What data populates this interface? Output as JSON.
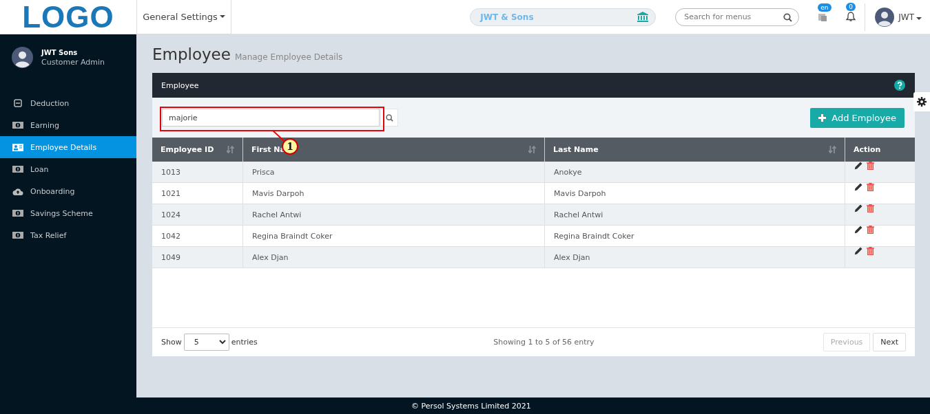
{
  "topbar": {
    "logo": "LOGO",
    "menu": "General Settings",
    "company": "JWT & Sons",
    "search": {
      "placeholder": "Search for menus"
    },
    "language_badge": "en",
    "notifications": "0",
    "user": "JWT"
  },
  "sidebar": {
    "user": {
      "name": "JWT Sons",
      "role": "Customer Admin"
    },
    "items": [
      {
        "label": "Deduction",
        "kind": "minus",
        "selected": false
      },
      {
        "label": "Earning",
        "kind": "bill",
        "selected": false
      },
      {
        "label": "Employee Details",
        "kind": "card",
        "selected": true
      },
      {
        "label": "Loan",
        "kind": "bill",
        "selected": false
      },
      {
        "label": "Onboarding",
        "kind": "cloud",
        "selected": false
      },
      {
        "label": "Savings Scheme",
        "kind": "bill",
        "selected": false
      },
      {
        "label": "Tax Relief",
        "kind": "bill",
        "selected": false
      }
    ]
  },
  "page": {
    "title": "Employee",
    "subtitle": "Manage Employee Details"
  },
  "panel": {
    "title": "Employee",
    "search": {
      "value": "majorie"
    },
    "add_button": "Add Employee",
    "callout": "1"
  },
  "table": {
    "columns": [
      {
        "label": "Employee ID",
        "sortable": true
      },
      {
        "label": "First Na",
        "sortable": true
      },
      {
        "label": "Last Name",
        "sortable": true
      },
      {
        "label": "Action",
        "sortable": false
      }
    ],
    "rows": [
      [
        "1013",
        "Prisca",
        "Anokye"
      ],
      [
        "1021",
        "Mavis Darpoh",
        "Mavis Darpoh"
      ],
      [
        "1024",
        "Rachel Antwi",
        "Rachel Antwi"
      ],
      [
        "1042",
        "Regina Braindt Coker",
        "Regina Braindt Coker"
      ],
      [
        "1049",
        "Alex Djan",
        "Alex Djan"
      ]
    ]
  },
  "pagination": {
    "show": "Show",
    "page_size": "5",
    "entries": "entries",
    "info": "Showing 1 to 5 of 56 entry",
    "buttons": [
      {
        "label": "Previous",
        "disabled": true
      },
      {
        "label": "Next",
        "disabled": false
      }
    ]
  },
  "footer": "© Persol Systems Limited 2021"
}
